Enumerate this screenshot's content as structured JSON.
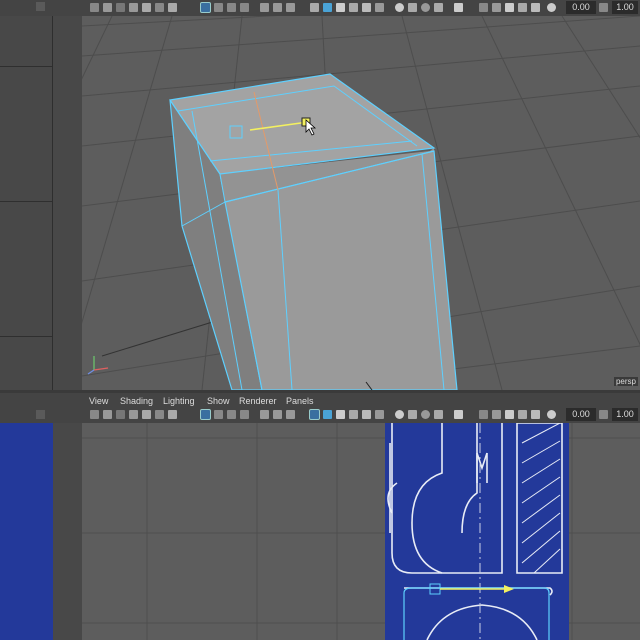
{
  "top_viewport": {
    "camera_label": "persp",
    "toolbar": {
      "value_a": "0.00",
      "value_b": "1.00"
    }
  },
  "bottom_viewport": {
    "menu": [
      "View",
      "Shading",
      "Lighting",
      "Show",
      "Renderer",
      "Panels"
    ],
    "toolbar": {
      "value_a": "0.00",
      "value_b": "1.00"
    }
  },
  "colors": {
    "viewport_bg": "#5d5d5d",
    "grid_line": "#505050",
    "panel_bg": "#444444",
    "selection_cyan": "#5ed0ff",
    "blueprint": "#23399a",
    "mesh_face": "#9a9a9a"
  }
}
